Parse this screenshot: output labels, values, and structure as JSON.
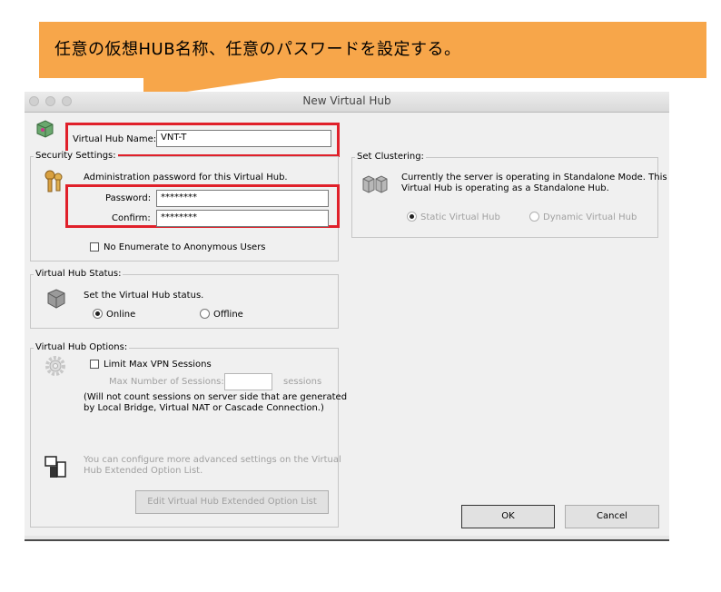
{
  "callout": {
    "text": "任意の仮想HUB名称、任意のパスワードを設定する。",
    "color": "#f7a64a"
  },
  "window": {
    "title": "New Virtual Hub"
  },
  "hub_name": {
    "label": "Virtual Hub Name:",
    "value": "VNT-T"
  },
  "security": {
    "legend": "Security Settings:",
    "description": "Administration password for this Virtual Hub.",
    "password_label": "Password:",
    "password_value": "********",
    "confirm_label": "Confirm:",
    "confirm_value": "********",
    "no_enumerate_label": "No Enumerate to Anonymous Users",
    "no_enumerate_checked": false
  },
  "status": {
    "legend": "Virtual Hub Status:",
    "description": "Set the Virtual Hub status.",
    "online_label": "Online",
    "offline_label": "Offline",
    "selected": "Online"
  },
  "options": {
    "legend": "Virtual Hub Options:",
    "limit_label": "Limit Max VPN Sessions",
    "limit_checked": false,
    "max_label": "Max Number of Sessions:",
    "max_value": "",
    "sessions_unit": "sessions",
    "note_line1": "(Will not count sessions on server side that are generated",
    "note_line2": "by Local Bridge, Virtual NAT or Cascade Connection.)",
    "advanced_line1": "You can configure more advanced settings on the Virtual",
    "advanced_line2": "Hub Extended Option List.",
    "edit_button": "Edit Virtual Hub Extended Option List"
  },
  "clustering": {
    "legend": "Set Clustering:",
    "line1": "Currently the server is operating in Standalone Mode. This",
    "line2": "Virtual Hub is operating as a Standalone Hub.",
    "static_label": "Static Virtual Hub",
    "dynamic_label": "Dynamic Virtual Hub",
    "selected": "Static Virtual Hub"
  },
  "buttons": {
    "ok": "OK",
    "cancel": "Cancel"
  },
  "colors": {
    "highlight": "#e0202a",
    "dialog_bg": "#f0f0f0"
  }
}
